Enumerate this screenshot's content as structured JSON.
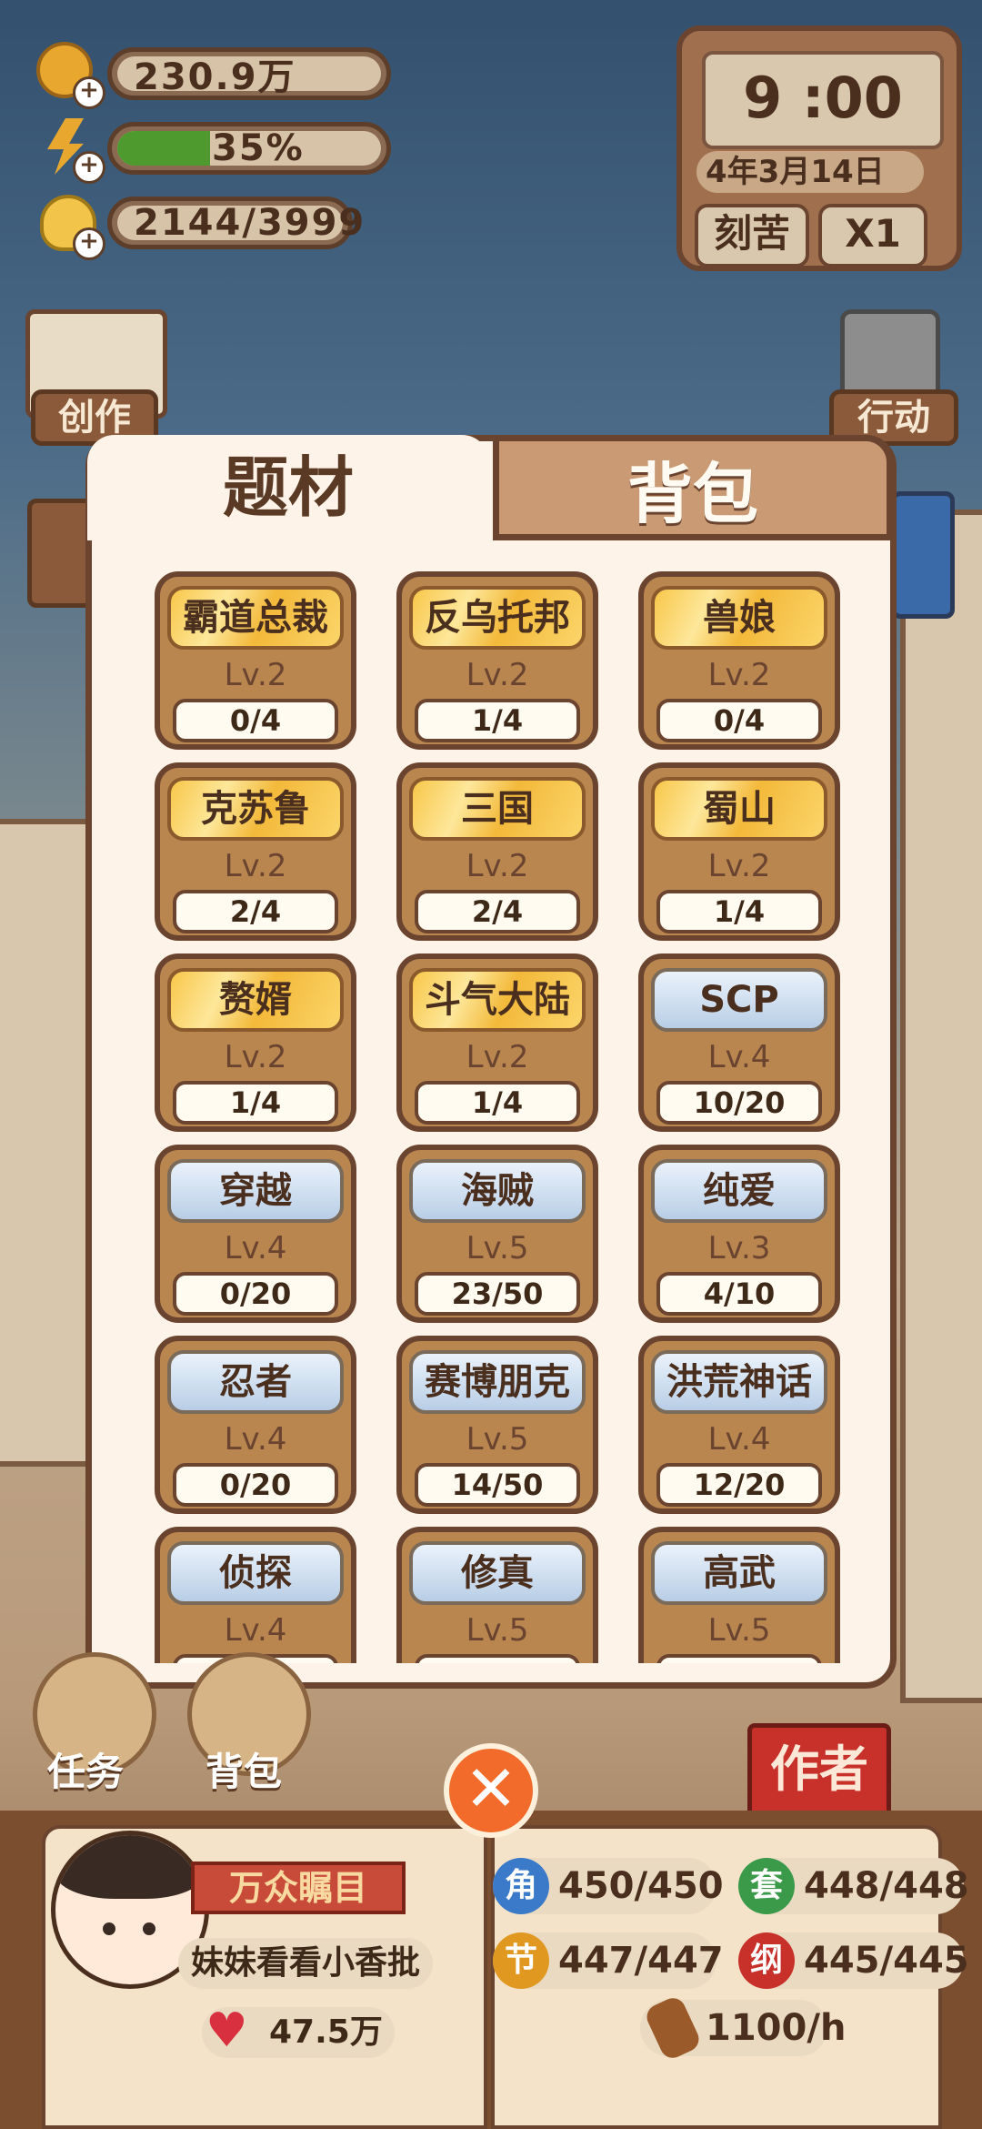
{
  "hud": {
    "coins": "230.9万",
    "energy": "35%",
    "energy_pct": 35,
    "ideas": "2144/3999"
  },
  "clock": {
    "time": "9 :00",
    "date": "4年3月14日",
    "mode": "刻苦",
    "speed": "X1"
  },
  "side": {
    "create": "创作",
    "action": "行动",
    "task": "任务",
    "bag": "背包",
    "author": "作者"
  },
  "modal": {
    "tab_active": "题材",
    "tab_inactive": "背包",
    "items": [
      {
        "name": "霸道总裁",
        "level": "Lv.2",
        "progress": "0/4",
        "style": "gold"
      },
      {
        "name": "反乌托邦",
        "level": "Lv.2",
        "progress": "1/4",
        "style": "gold"
      },
      {
        "name": "兽娘",
        "level": "Lv.2",
        "progress": "0/4",
        "style": "gold"
      },
      {
        "name": "克苏鲁",
        "level": "Lv.2",
        "progress": "2/4",
        "style": "gold"
      },
      {
        "name": "三国",
        "level": "Lv.2",
        "progress": "2/4",
        "style": "gold"
      },
      {
        "name": "蜀山",
        "level": "Lv.2",
        "progress": "1/4",
        "style": "gold"
      },
      {
        "name": "赘婿",
        "level": "Lv.2",
        "progress": "1/4",
        "style": "gold"
      },
      {
        "name": "斗气大陆",
        "level": "Lv.2",
        "progress": "1/4",
        "style": "gold"
      },
      {
        "name": "SCP",
        "level": "Lv.4",
        "progress": "10/20",
        "style": "blue"
      },
      {
        "name": "穿越",
        "level": "Lv.4",
        "progress": "0/20",
        "style": "blue"
      },
      {
        "name": "海贼",
        "level": "Lv.5",
        "progress": "23/50",
        "style": "blue"
      },
      {
        "name": "纯爱",
        "level": "Lv.3",
        "progress": "4/10",
        "style": "blue"
      },
      {
        "name": "忍者",
        "level": "Lv.4",
        "progress": "0/20",
        "style": "blue"
      },
      {
        "name": "赛博朋克",
        "level": "Lv.5",
        "progress": "14/50",
        "style": "blue"
      },
      {
        "name": "洪荒神话",
        "level": "Lv.4",
        "progress": "12/20",
        "style": "blue"
      },
      {
        "name": "侦探",
        "level": "Lv.4",
        "progress": "",
        "style": "blue"
      },
      {
        "name": "修真",
        "level": "Lv.5",
        "progress": "",
        "style": "blue"
      },
      {
        "name": "高武",
        "level": "Lv.5",
        "progress": "",
        "style": "blue"
      }
    ]
  },
  "profile": {
    "title": "万众瞩目",
    "name": "妹妹看看小香批",
    "likes": "47.5万"
  },
  "stats": {
    "jiao": {
      "icon": "角",
      "value": "450/450"
    },
    "tao": {
      "icon": "套",
      "value": "448/448"
    },
    "jie": {
      "icon": "节",
      "value": "447/447"
    },
    "gang": {
      "icon": "纲",
      "value": "445/445"
    },
    "rate": "1100/h"
  }
}
